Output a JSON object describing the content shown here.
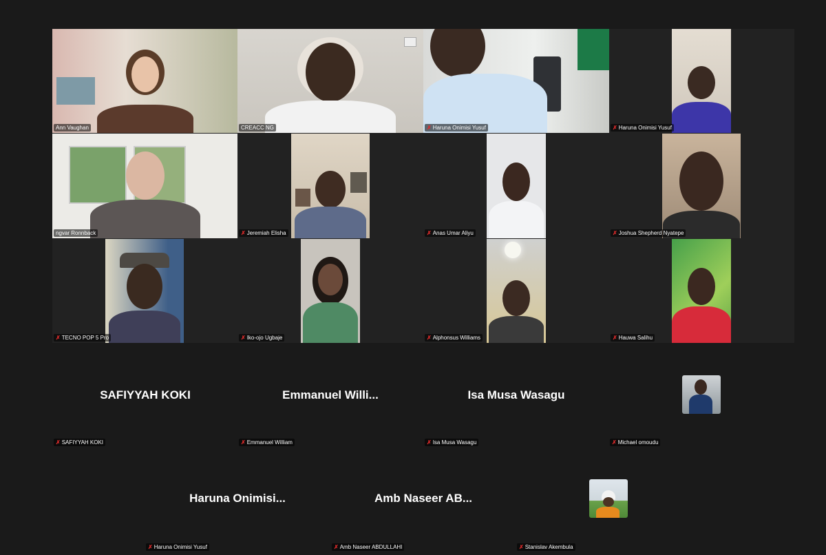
{
  "participants_video": [
    {
      "name": "Ann Vaughan",
      "muted": false
    },
    {
      "name": "CREACC NG",
      "muted": false
    },
    {
      "name": "Haruna Onimisi Yusuf",
      "muted": true
    },
    {
      "name": "Haruna Onimisi Yusuf",
      "muted": true
    },
    {
      "name": "ngvar Ronnback",
      "muted": false
    },
    {
      "name": "Jeremiah Elisha",
      "muted": true
    },
    {
      "name": "Anas Umar Aliyu",
      "muted": true
    },
    {
      "name": "Joshua Shepherd Nyatepe",
      "muted": true
    },
    {
      "name": "TECNO POP 5 Pro",
      "muted": true
    },
    {
      "name": "Iko-ojo Ugbaje",
      "muted": true
    },
    {
      "name": "Alphonsus Williams",
      "muted": true
    },
    {
      "name": "Hauwa Salihu",
      "muted": true
    }
  ],
  "participants_novideo": [
    {
      "display": "SAFIYYAH KOKI",
      "name": "SAFIYYAH KOKI"
    },
    {
      "display": "Emmanuel  Willi...",
      "name": "Emmanuel William"
    },
    {
      "display": "Isa Musa Wasagu",
      "name": "Isa Musa Wasagu"
    },
    {
      "display": "",
      "name": "Michael omoudu"
    },
    {
      "display": "Haruna  Onimisi...",
      "name": "Haruna Onimisi Yusuf"
    },
    {
      "display": "Amb  Naseer  AB...",
      "name": "Amb Naseer ABDULLAHI"
    },
    {
      "display": "",
      "name": "Stanislav Akembula"
    }
  ],
  "colors": {
    "background": "#1a1a1a",
    "active_speaker": "#3ecf6a",
    "muted_icon": "#e02b2b"
  }
}
